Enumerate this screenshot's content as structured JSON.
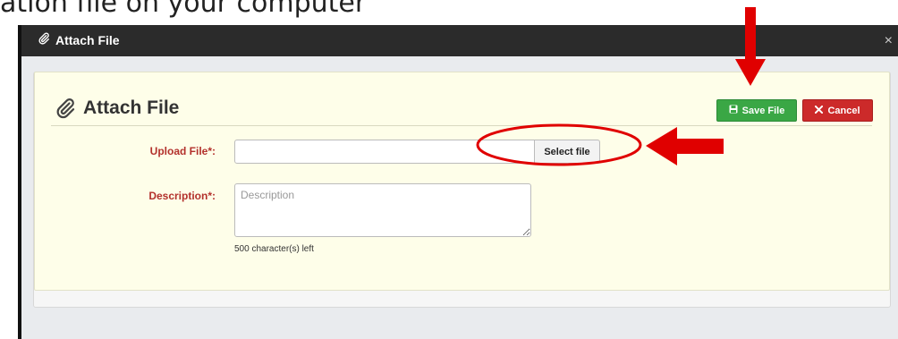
{
  "slide": {
    "title": "ation file on your computer"
  },
  "dialog": {
    "title": "Attach File",
    "close_glyph": "×"
  },
  "panel": {
    "heading": "Attach File",
    "save_label": "Save File",
    "cancel_label": "Cancel"
  },
  "form": {
    "upload_label": "Upload File*:",
    "select_file_label": "Select file",
    "upload_value": "",
    "description_label": "Description*:",
    "description_placeholder": "Description",
    "description_value": "",
    "chars_left": "500 character(s) left"
  },
  "icons": {
    "paperclip": "paperclip-icon",
    "save": "floppy-disk-icon",
    "cancel": "x-icon",
    "close": "close-icon"
  },
  "colors": {
    "titlebar": "#2b2b2b",
    "panel_bg": "#fefee9",
    "save_green": "#3aa745",
    "cancel_red": "#cc2a2a",
    "label_red": "#b3312c",
    "annotation_red": "#e00000"
  }
}
